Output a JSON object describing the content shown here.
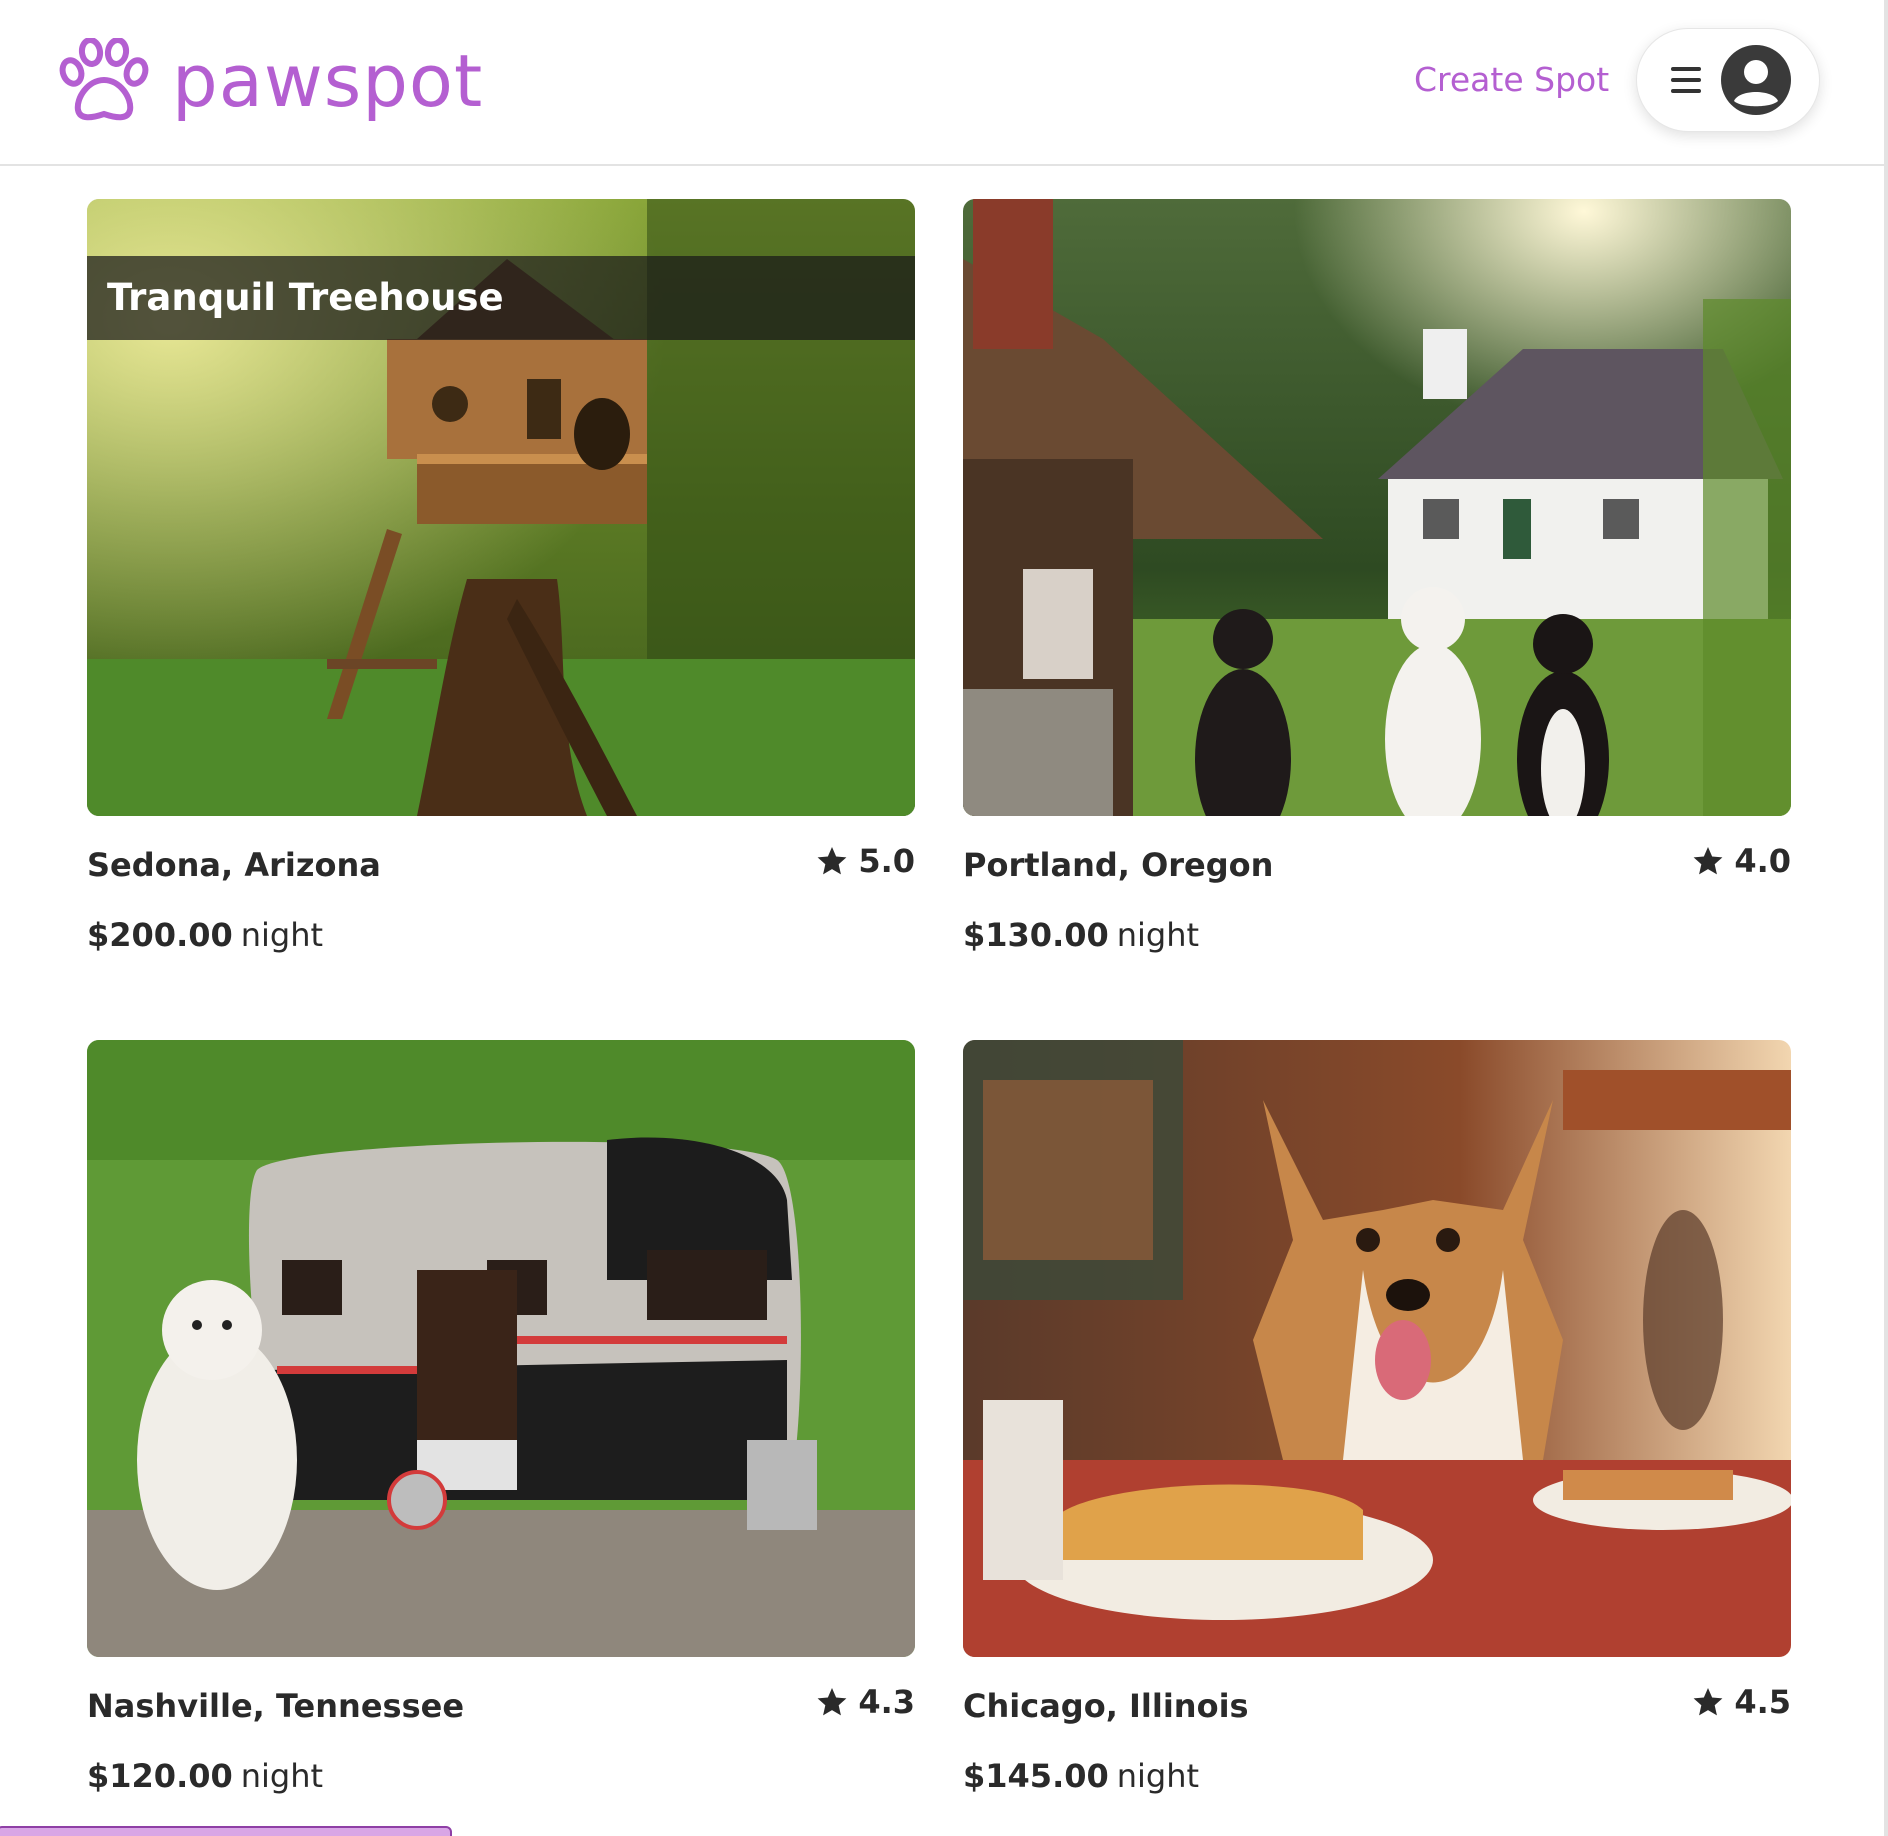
{
  "header": {
    "brand": "pawspot",
    "logo_icon": "paw-print-icon",
    "create_spot_label": "Create Spot",
    "menu_icon": "hamburger-menu-icon",
    "avatar_icon": "user-avatar-icon"
  },
  "colors": {
    "brand": "#b45fd1",
    "text": "#2a2a2a"
  },
  "spots": [
    {
      "tooltip": "Tranquil Treehouse",
      "location": "Sedona, Arizona",
      "rating": "5.0",
      "price": "$200.00",
      "unit": "night",
      "image": "treehouse-in-forest"
    },
    {
      "location": "Portland, Oregon",
      "rating": "4.0",
      "price": "$130.00",
      "unit": "night",
      "image": "cottage-with-three-cats"
    },
    {
      "location": "Nashville, Tennessee",
      "rating": "4.3",
      "price": "$120.00",
      "unit": "night",
      "image": "dog-camper-trailer"
    },
    {
      "location": "Chicago, Illinois",
      "rating": "4.5",
      "price": "$145.00",
      "unit": "night",
      "image": "corgi-at-diner"
    }
  ]
}
